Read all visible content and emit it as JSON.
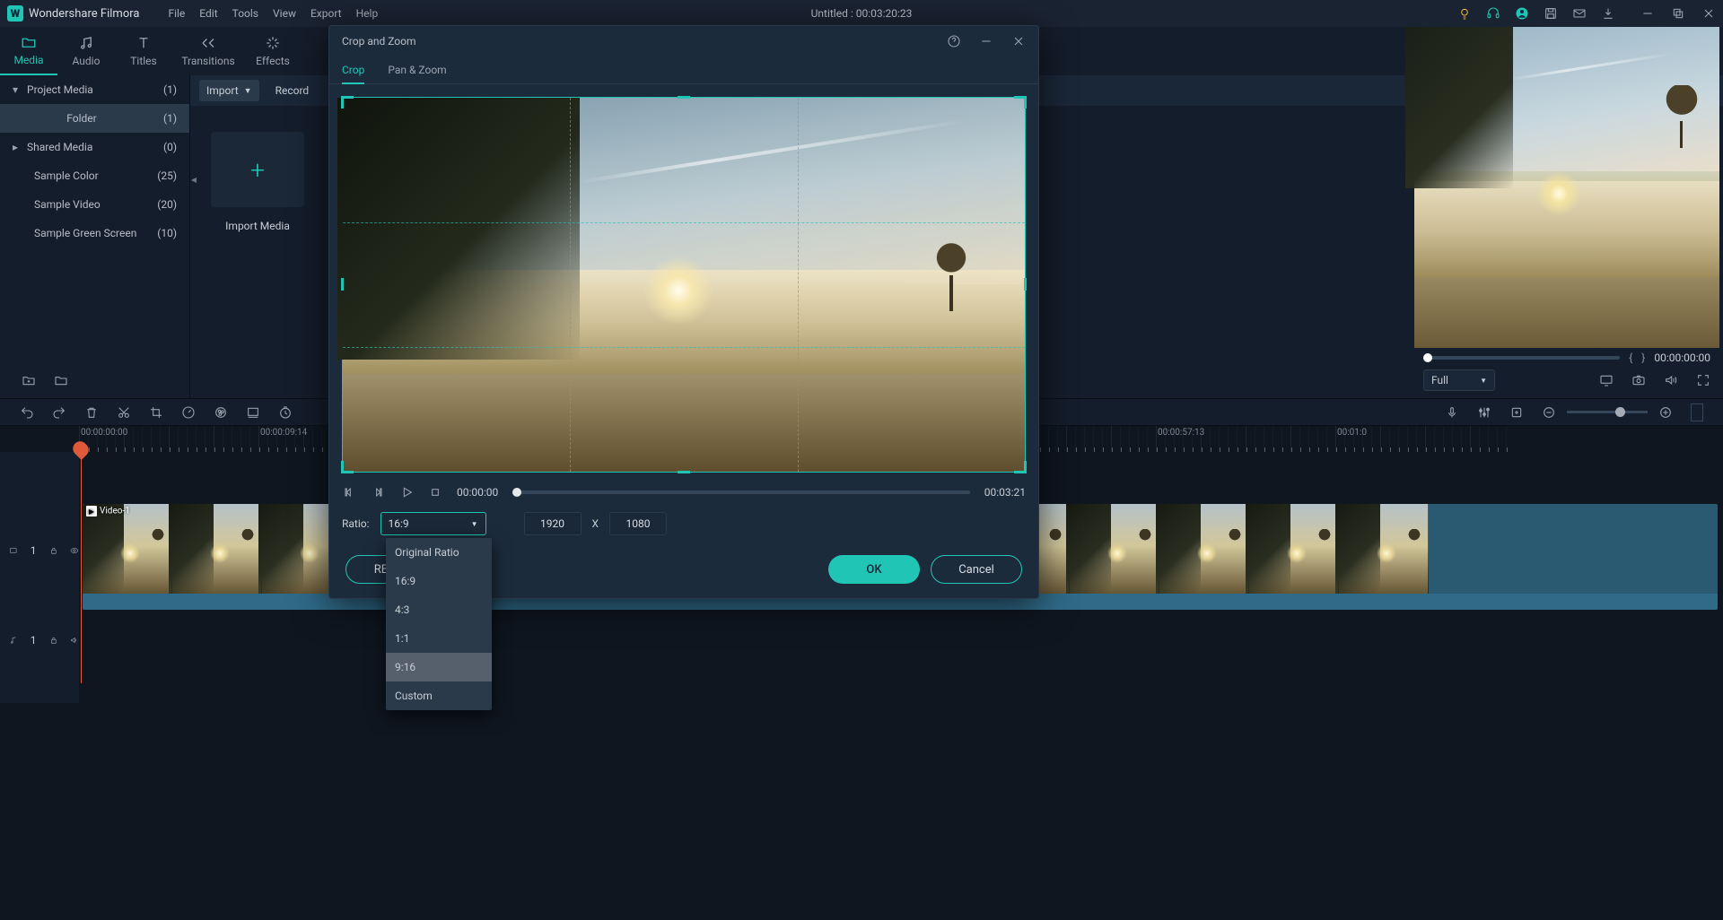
{
  "app": {
    "name": "Wondershare Filmora"
  },
  "menu": [
    "File",
    "Edit",
    "Tools",
    "View",
    "Export",
    "Help"
  ],
  "title_center": "Untitled : 00:03:20:23",
  "top_tabs": [
    {
      "label": "Media",
      "icon": "folder-icon",
      "active": true
    },
    {
      "label": "Audio",
      "icon": "music-icon"
    },
    {
      "label": "Titles",
      "icon": "text-icon"
    },
    {
      "label": "Transitions",
      "icon": "transition-icon"
    },
    {
      "label": "Effects",
      "icon": "sparkle-icon"
    }
  ],
  "sidebar": {
    "items": [
      {
        "label": "Project Media",
        "count": "(1)",
        "arrow": "▾"
      },
      {
        "label": "Folder",
        "count": "(1)",
        "selected": true,
        "sub": true
      },
      {
        "label": "Shared Media",
        "count": "(0)",
        "arrow": "▸"
      },
      {
        "label": "Sample Color",
        "count": "(25)",
        "sub": true
      },
      {
        "label": "Sample Video",
        "count": "(20)",
        "sub": true
      },
      {
        "label": "Sample Green Screen",
        "count": "(10)",
        "sub": true
      }
    ]
  },
  "content_bar": {
    "import": "Import",
    "record": "Record"
  },
  "import_tile": {
    "label": "Import Media"
  },
  "preview": {
    "time": "00:00:00:00",
    "quality_label": "Full"
  },
  "modal": {
    "title": "Crop and Zoom",
    "tabs": [
      "Crop",
      "Pan & Zoom"
    ],
    "active_tab": "Crop",
    "play_time_left": "00:00:00",
    "play_time_right": "00:03:21",
    "ratio_label": "Ratio:",
    "ratio_value": "16:9",
    "width": "1920",
    "height": "1080",
    "x": "X",
    "reset": "RESET",
    "ok": "OK",
    "cancel": "Cancel"
  },
  "ratio_options": [
    "Original Ratio",
    "16:9",
    "4:3",
    "1:1",
    "9:16",
    "Custom"
  ],
  "ratio_hover": "9:16",
  "ruler": {
    "label1_pos": 90,
    "label1": "00:00:00:00",
    "label2_pos": 290,
    "label2": "00:00:09:14",
    "label3_pos": 1290,
    "label3": "00:00:57:13",
    "label4_pos": 1490,
    "label4": "00:01:0"
  },
  "clip": {
    "label": "Video-1"
  },
  "track_ids": {
    "video": "1",
    "audio": "1"
  }
}
